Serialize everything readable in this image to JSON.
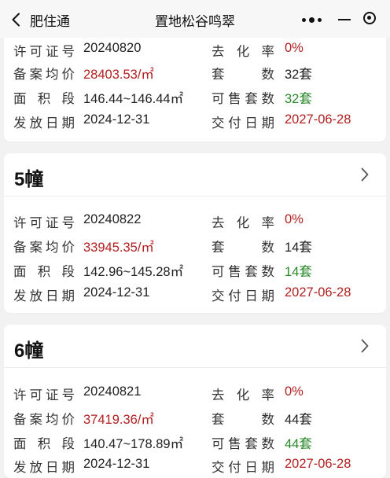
{
  "nav": {
    "app_title": "肥住通",
    "page_title": "置地松谷鸣翠"
  },
  "labels": {
    "permit": "许可证号",
    "avg_price": "备案均价",
    "area_range": "面积段",
    "issue_date": "发放日期",
    "sell_rate": "去化率",
    "units": "套数",
    "for_sale": "可售套数",
    "delivery": "交付日期"
  },
  "colors": {
    "price": "#b32020",
    "rate": "#b32020",
    "for_sale": "#2a8a2a",
    "delivery": "#b32020"
  },
  "buildings": [
    {
      "name": "",
      "permit": "20240820",
      "avg_price": "28403.53/㎡",
      "area_range": "146.44~146.44㎡",
      "issue_date": "2024-12-31",
      "sell_rate": "0%",
      "units": "32套",
      "for_sale": "32套",
      "delivery": "2027-06-28"
    },
    {
      "name": "5幢",
      "permit": "20240822",
      "avg_price": "33945.35/㎡",
      "area_range": "142.96~145.28㎡",
      "issue_date": "2024-12-31",
      "sell_rate": "0%",
      "units": "14套",
      "for_sale": "14套",
      "delivery": "2027-06-28"
    },
    {
      "name": "6幢",
      "permit": "20240821",
      "avg_price": "37419.36/㎡",
      "area_range": "140.47~178.89㎡",
      "issue_date": "2024-12-31",
      "sell_rate": "0%",
      "units": "44套",
      "for_sale": "44套",
      "delivery": "2027-06-28"
    }
  ]
}
